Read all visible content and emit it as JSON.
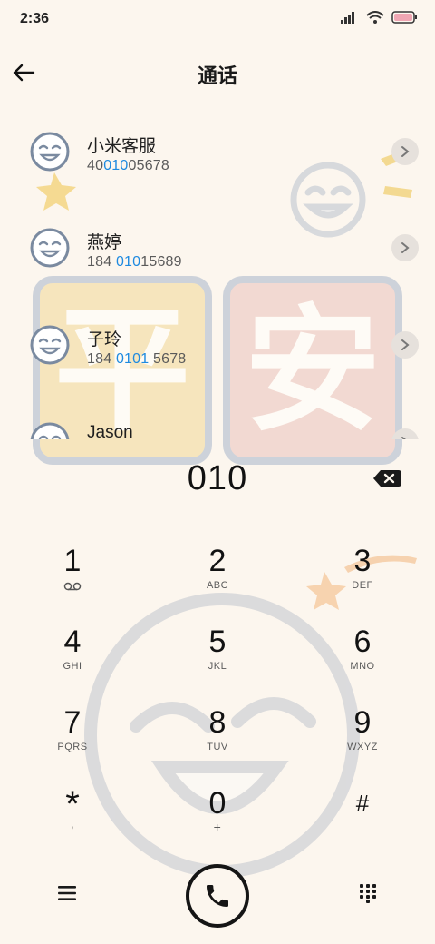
{
  "status_bar": {
    "time": "2:36"
  },
  "header": {
    "title": "通话"
  },
  "contacts": [
    {
      "name": "小米客服",
      "num_pre": "40",
      "num_match": "010",
      "num_post": "05678"
    },
    {
      "name": "燕婷",
      "num_pre": "184 ",
      "num_match": "010",
      "num_post": "15689"
    },
    {
      "name": "子玲",
      "num_pre": "184 ",
      "num_match": "0101",
      "num_post": " 5678"
    },
    {
      "name": "Jason",
      "num_pre": "",
      "num_match": "",
      "num_post": ""
    }
  ],
  "dialer": {
    "number": "010"
  },
  "keypad": [
    {
      "digit": "1",
      "letters": ""
    },
    {
      "digit": "2",
      "letters": "ABC"
    },
    {
      "digit": "3",
      "letters": "DEF"
    },
    {
      "digit": "4",
      "letters": "GHI"
    },
    {
      "digit": "5",
      "letters": "JKL"
    },
    {
      "digit": "6",
      "letters": "MNO"
    },
    {
      "digit": "7",
      "letters": "PQRS"
    },
    {
      "digit": "8",
      "letters": "TUV"
    },
    {
      "digit": "9",
      "letters": "WXYZ"
    },
    {
      "digit": "*",
      "letters": ","
    },
    {
      "digit": "0",
      "letters": "+"
    },
    {
      "digit": "#",
      "letters": ""
    }
  ],
  "icons": {
    "back": "arrow-left-icon",
    "delete": "backspace-icon",
    "menu": "hamburger-menu-icon",
    "call": "phone-icon",
    "dialpad": "dialpad-icon",
    "voicemail": "voicemail-icon"
  },
  "colors": {
    "background": "#fcf6ee",
    "match_highlight": "#1e8ae0",
    "call_ring": "#151515"
  }
}
